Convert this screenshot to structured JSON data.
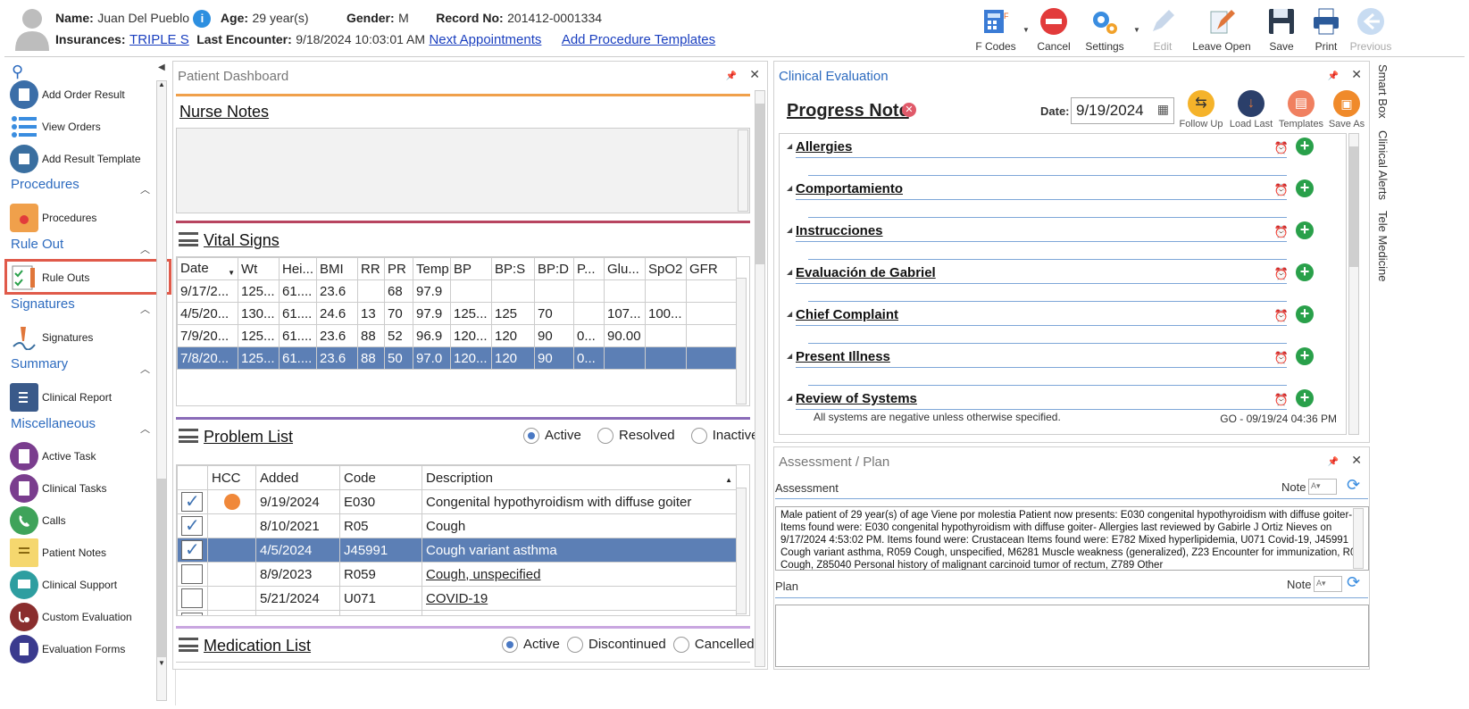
{
  "header": {
    "name_label": "Name:",
    "name": "Juan Del Pueblo",
    "age_label": "Age:",
    "age": "29 year(s)",
    "gender_label": "Gender:",
    "gender": "M",
    "record_label": "Record No:",
    "record": "201412-0001334",
    "ins_label": "Insurances:",
    "ins": "TRIPLE S",
    "last_label": "Last Encounter:",
    "last": "9/18/2024 10:03:01 AM",
    "next_appt": "Next Appointments",
    "add_proc": "Add Procedure Templates"
  },
  "toolbar": {
    "fcodes": "F Codes",
    "cancel": "Cancel",
    "settings": "Settings",
    "edit": "Edit",
    "leave_open": "Leave Open",
    "save": "Save",
    "print": "Print",
    "previous": "Previous"
  },
  "nav": {
    "add_order_result": "Add Order Result",
    "view_orders": "View Orders",
    "add_result_template": "Add Result Template",
    "procedures_section": "Procedures",
    "procedures": "Procedures",
    "ruleout_section": "Rule Out",
    "rule_outs": "Rule Outs",
    "signatures_section": "Signatures",
    "signatures": "Signatures",
    "summary_section": "Summary",
    "clinical_report": "Clinical Report",
    "misc_section": "Miscellaneous",
    "active_task": "Active Task",
    "clinical_tasks": "Clinical Tasks",
    "calls": "Calls",
    "patient_notes": "Patient Notes",
    "clinical_support": "Clinical Support",
    "custom_evaluation": "Custom Evaluation",
    "evaluation_forms": "Evaluation Forms"
  },
  "dashboard": {
    "title": "Patient Dashboard",
    "nurse_notes": "Nurse Notes",
    "vital_signs": "Vital Signs",
    "vs_headers": [
      "Date",
      "Wt",
      "Hei...",
      "BMI",
      "RR",
      "PR",
      "Temp",
      "BP",
      "BP:S",
      "BP:D",
      "P...",
      "Glu...",
      "SpO2",
      "GFR"
    ],
    "vs_rows": [
      [
        "9/17/2...",
        "125...",
        "61....",
        "23.6",
        "",
        "68",
        "97.9",
        "",
        "",
        "",
        "",
        "",
        "",
        ""
      ],
      [
        "4/5/20...",
        "130...",
        "61....",
        "24.6",
        "13",
        "70",
        "97.9",
        "125...",
        "125",
        "70",
        "",
        "107...",
        "100...",
        ""
      ],
      [
        "7/9/20...",
        "125...",
        "61....",
        "23.6",
        "88",
        "52",
        "96.9",
        "120...",
        "120",
        "90",
        "0...",
        "90.00",
        "",
        ""
      ],
      [
        "7/8/20...",
        "125...",
        "61....",
        "23.6",
        "88",
        "50",
        "97.0",
        "120...",
        "120",
        "90",
        "0...",
        "",
        "",
        ""
      ]
    ],
    "problem_list": "Problem List",
    "pl_active": "Active",
    "pl_resolved": "Resolved",
    "pl_inactive": "Inactive",
    "pl_headers": [
      "HCC",
      "Added",
      "Code",
      "Description"
    ],
    "pl_rows": [
      [
        "9/19/2024",
        "E030",
        "Congenital hypothyroidism with diffuse goiter"
      ],
      [
        "8/10/2021",
        "R05",
        "Cough"
      ],
      [
        "4/5/2024",
        "J45991",
        "Cough variant asthma"
      ],
      [
        "8/9/2023",
        "R059",
        "Cough, unspecified"
      ],
      [
        "5/21/2024",
        "U071",
        "COVID-19"
      ]
    ],
    "medication_list": "Medication List",
    "ml_active": "Active",
    "ml_discontinued": "Discontinued",
    "ml_cancelled": "Cancelled"
  },
  "clinical": {
    "title": "Clinical Evaluation",
    "progress_note": "Progress Note",
    "date_label": "Date:",
    "date": "9/19/2024",
    "follow_up": "Follow Up",
    "load_last": "Load Last",
    "templates": "Templates",
    "save_as": "Save As",
    "sections": [
      "Allergies",
      "Comportamiento",
      "Instrucciones",
      "Evaluación de Gabriel",
      "Chief Complaint",
      "Present Illness",
      "Review of Systems"
    ],
    "ros_text": "All systems are negative unless otherwise specified.",
    "ros_sig": "GO - 09/19/24 04:36 PM"
  },
  "assessment": {
    "title": "Assessment / Plan",
    "assessment_label": "Assessment",
    "note_label": "Note",
    "text": "Male patient of 29 year(s) of age Viene por molestia Patient now presents: E030 congenital hypothyroidism with diffuse goiter-. Items found were: E030 congenital hypothyroidism with diffuse goiter-   Allergies last reviewed by Gabirle J Ortiz Nieves on 9/17/2024 4:53:02 PM.    Items found were:  Crustacean  Items found were:  E782 Mixed hyperlipidemia, U071 Covid-19, J45991 Cough variant asthma, R059 Cough, unspecified, M6281 Muscle weakness (generalized), Z23 Encounter for immunization, R05 Cough, Z85040 Personal history of malignant carcinoid tumor of rectum, Z789 Other",
    "plan_label": "Plan",
    "plan_note_label": "Note"
  },
  "side_tabs": [
    "Smart Box",
    "Clinical Alerts",
    "Tele Medicine"
  ],
  "colors": {
    "accent_blue": "#2d6bbf",
    "highlight_red": "#e05a4a",
    "selected_row": "#5c7fb5",
    "orange_bar": "#f0a04b",
    "purple_bar": "#8a6bb8",
    "crimson_bar": "#b84560",
    "green_add": "#29a04a"
  }
}
